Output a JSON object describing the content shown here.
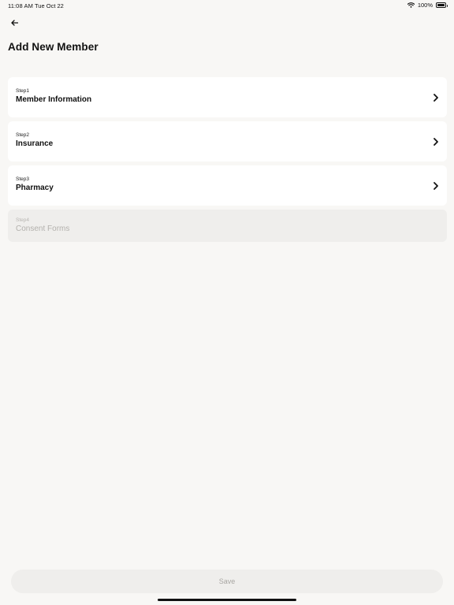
{
  "status_bar": {
    "time": "11:08 AM",
    "date": "Tue Oct 22",
    "battery": "100%",
    "wifi_icon": "wifi-icon",
    "battery_icon": "battery-icon"
  },
  "header": {
    "back_icon": "arrow-left-icon",
    "title": "Add New Member"
  },
  "steps": [
    {
      "number": "Step1",
      "title": "Member Information",
      "enabled": true,
      "icon": "chevron-right-icon"
    },
    {
      "number": "Step2",
      "title": "Insurance",
      "enabled": true,
      "icon": "chevron-right-icon"
    },
    {
      "number": "Step3",
      "title": "Pharmacy",
      "enabled": true,
      "icon": "chevron-right-icon"
    },
    {
      "number": "Step4",
      "title": "Consent Forms",
      "enabled": false
    }
  ],
  "footer": {
    "save_label": "Save",
    "save_enabled": false
  }
}
